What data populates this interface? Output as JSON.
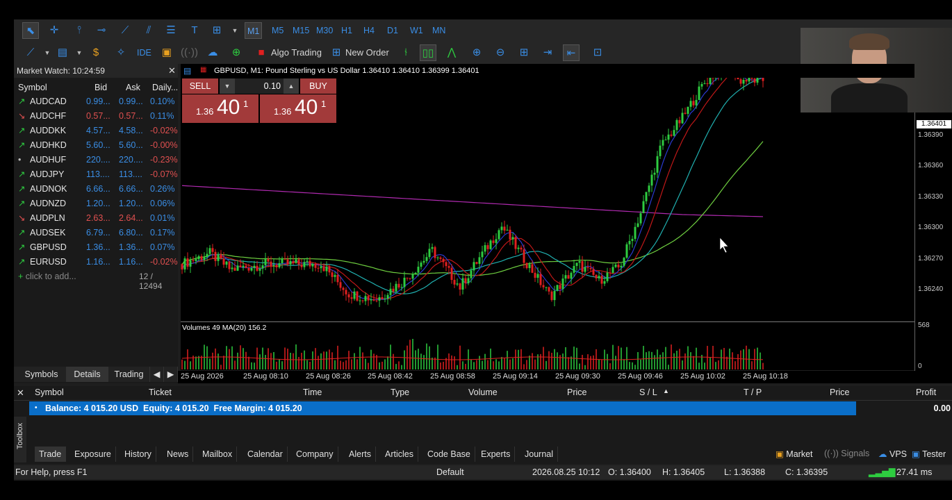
{
  "toolbar": {
    "timeframes": [
      "M1",
      "M5",
      "M15",
      "M30",
      "H1",
      "H4",
      "D1",
      "W1",
      "MN"
    ],
    "active_timeframe": "M1",
    "ide_label": "IDE",
    "algo_trading_label": "Algo Trading",
    "new_order_label": "New Order"
  },
  "market_watch": {
    "title": "Market Watch: 10:24:59",
    "columns": [
      "Symbol",
      "Bid",
      "Ask",
      "Daily..."
    ],
    "rows": [
      {
        "symbol": "AUDCAD",
        "bid": "0.99...",
        "ask": "0.99...",
        "daily": "0.10%",
        "dir": "up"
      },
      {
        "symbol": "AUDCHF",
        "bid": "0.57...",
        "ask": "0.57...",
        "daily": "0.11%",
        "dir": "down"
      },
      {
        "symbol": "AUDDKK",
        "bid": "4.57...",
        "ask": "4.58...",
        "daily": "-0.02%",
        "dir": "up"
      },
      {
        "symbol": "AUDHKD",
        "bid": "5.60...",
        "ask": "5.60...",
        "daily": "-0.00%",
        "dir": "up"
      },
      {
        "symbol": "AUDHUF",
        "bid": "220....",
        "ask": "220....",
        "daily": "-0.23%",
        "dir": "none"
      },
      {
        "symbol": "AUDJPY",
        "bid": "113....",
        "ask": "113....",
        "daily": "-0.07%",
        "dir": "up"
      },
      {
        "symbol": "AUDNOK",
        "bid": "6.66...",
        "ask": "6.66...",
        "daily": "0.26%",
        "dir": "up"
      },
      {
        "symbol": "AUDNZD",
        "bid": "1.20...",
        "ask": "1.20...",
        "daily": "0.06%",
        "dir": "up"
      },
      {
        "symbol": "AUDPLN",
        "bid": "2.63...",
        "ask": "2.64...",
        "daily": "0.01%",
        "dir": "down"
      },
      {
        "symbol": "AUDSEK",
        "bid": "6.79...",
        "ask": "6.80...",
        "daily": "0.17%",
        "dir": "up"
      },
      {
        "symbol": "GBPUSD",
        "bid": "1.36...",
        "ask": "1.36...",
        "daily": "0.07%",
        "dir": "up"
      },
      {
        "symbol": "EURUSD",
        "bid": "1.16...",
        "ask": "1.16...",
        "daily": "-0.02%",
        "dir": "up"
      }
    ],
    "add_label": "click to add...",
    "count": "12 / 12494",
    "tabs": [
      "Symbols",
      "Details",
      "Trading"
    ],
    "active_tab": "Details"
  },
  "chart": {
    "header": "GBPUSD, M1:  Pound Sterling vs US Dollar  1.36410 1.36410 1.36399 1.36401",
    "sell_label": "SELL",
    "buy_label": "BUY",
    "lot": "0.10",
    "sell_prefix": "1.36",
    "sell_big": "40",
    "sell_sup": "1",
    "buy_prefix": "1.36",
    "buy_big": "40",
    "buy_sup": "1",
    "current_price": "1.36401",
    "price_ticks": [
      "1.36390",
      "1.36360",
      "1.36330",
      "1.36300",
      "1.36270",
      "1.36240"
    ],
    "volume_label": "Volumes 49 MA(20) 156.2",
    "volume_ticks": [
      "568",
      "0"
    ],
    "time_ticks": [
      "25 Aug 2026",
      "25 Aug 08:10",
      "25 Aug 08:26",
      "25 Aug 08:42",
      "25 Aug 08:58",
      "25 Aug 09:14",
      "25 Aug 09:30",
      "25 Aug 09:46",
      "25 Aug 10:02",
      "25 Aug 10:18"
    ],
    "colors": {
      "bull": "#2ecc40",
      "bear": "#e02020",
      "ma_fast": "#2a3ad0",
      "ma_mid": "#c01818",
      "ma_slow": "#20b0b0",
      "ma_green": "#6fd040",
      "ma_long": "#b02ab0"
    }
  },
  "chart_data": {
    "type": "candlestick",
    "symbol": "GBPUSD",
    "timeframe": "M1",
    "ylim": [
      1.3622,
      1.3641
    ],
    "last": {
      "open": 1.3641,
      "high": 1.3641,
      "low": 1.36399,
      "close": 1.36401
    },
    "volume_ma": 156.2,
    "volume_max_tick": 568
  },
  "toolbox": {
    "columns": [
      "Symbol",
      "Ticket",
      "Time",
      "Type",
      "Volume",
      "Price",
      "S / L",
      "T / P",
      "Price",
      "Profit"
    ],
    "balance_line": "Balance: 4 015.20 USD  Equity: 4 015.20  Free Margin: 4 015.20",
    "profit": "0.00",
    "side_label": "Toolbox",
    "tabs": [
      "Trade",
      "Exposure",
      "History",
      "News",
      "Mailbox",
      "Calendar",
      "Company",
      "Alerts",
      "Articles",
      "Code Base",
      "Experts",
      "Journal"
    ],
    "active_tab": "Trade",
    "right_items": [
      "Market",
      "Signals",
      "VPS",
      "Tester"
    ]
  },
  "status": {
    "help": "For Help, press F1",
    "profile": "Default",
    "datetime": "2026.08.25 10:12",
    "open": "O: 1.36400",
    "high": "H: 1.36405",
    "low": "L: 1.36388",
    "close": "C: 1.36395",
    "ping": "27.41 ms"
  }
}
